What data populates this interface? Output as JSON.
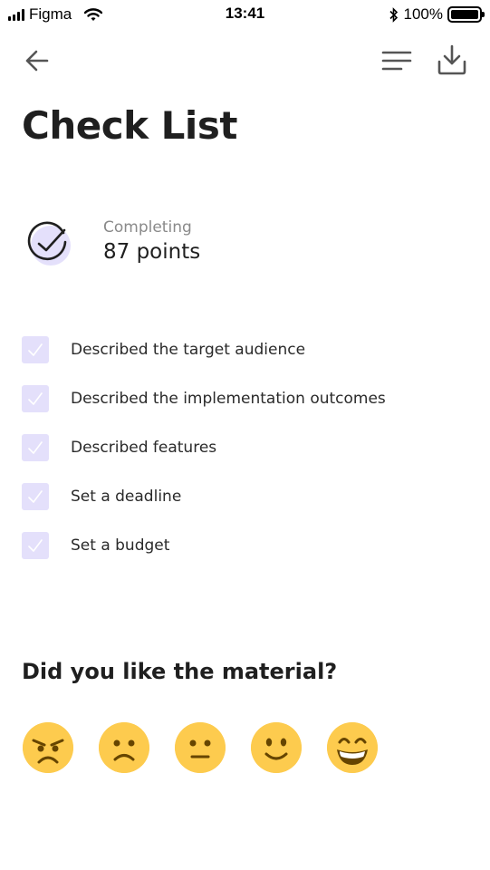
{
  "status_bar": {
    "carrier": "Figma",
    "time": "13:41",
    "battery": "100%"
  },
  "nav": {
    "back_icon": "arrow-left-icon",
    "menu_icon": "menu-icon",
    "download_icon": "download-icon"
  },
  "page": {
    "title": "Check List"
  },
  "progress": {
    "label": "Completing",
    "value": "87 points",
    "accent": "#e4e0fb"
  },
  "checklist": {
    "items": [
      {
        "label": "Described the target audience",
        "checked": true
      },
      {
        "label": "Described the implementation outcomes",
        "checked": true
      },
      {
        "label": "Described features",
        "checked": true
      },
      {
        "label": "Set a deadline",
        "checked": true
      },
      {
        "label": "Set a budget",
        "checked": true
      }
    ]
  },
  "rating": {
    "question": "Did you like the material?",
    "options": [
      "angry-face",
      "frowning-face",
      "neutral-face",
      "slightly-smiling-face",
      "grinning-face"
    ],
    "color": "#fdcb4e"
  }
}
